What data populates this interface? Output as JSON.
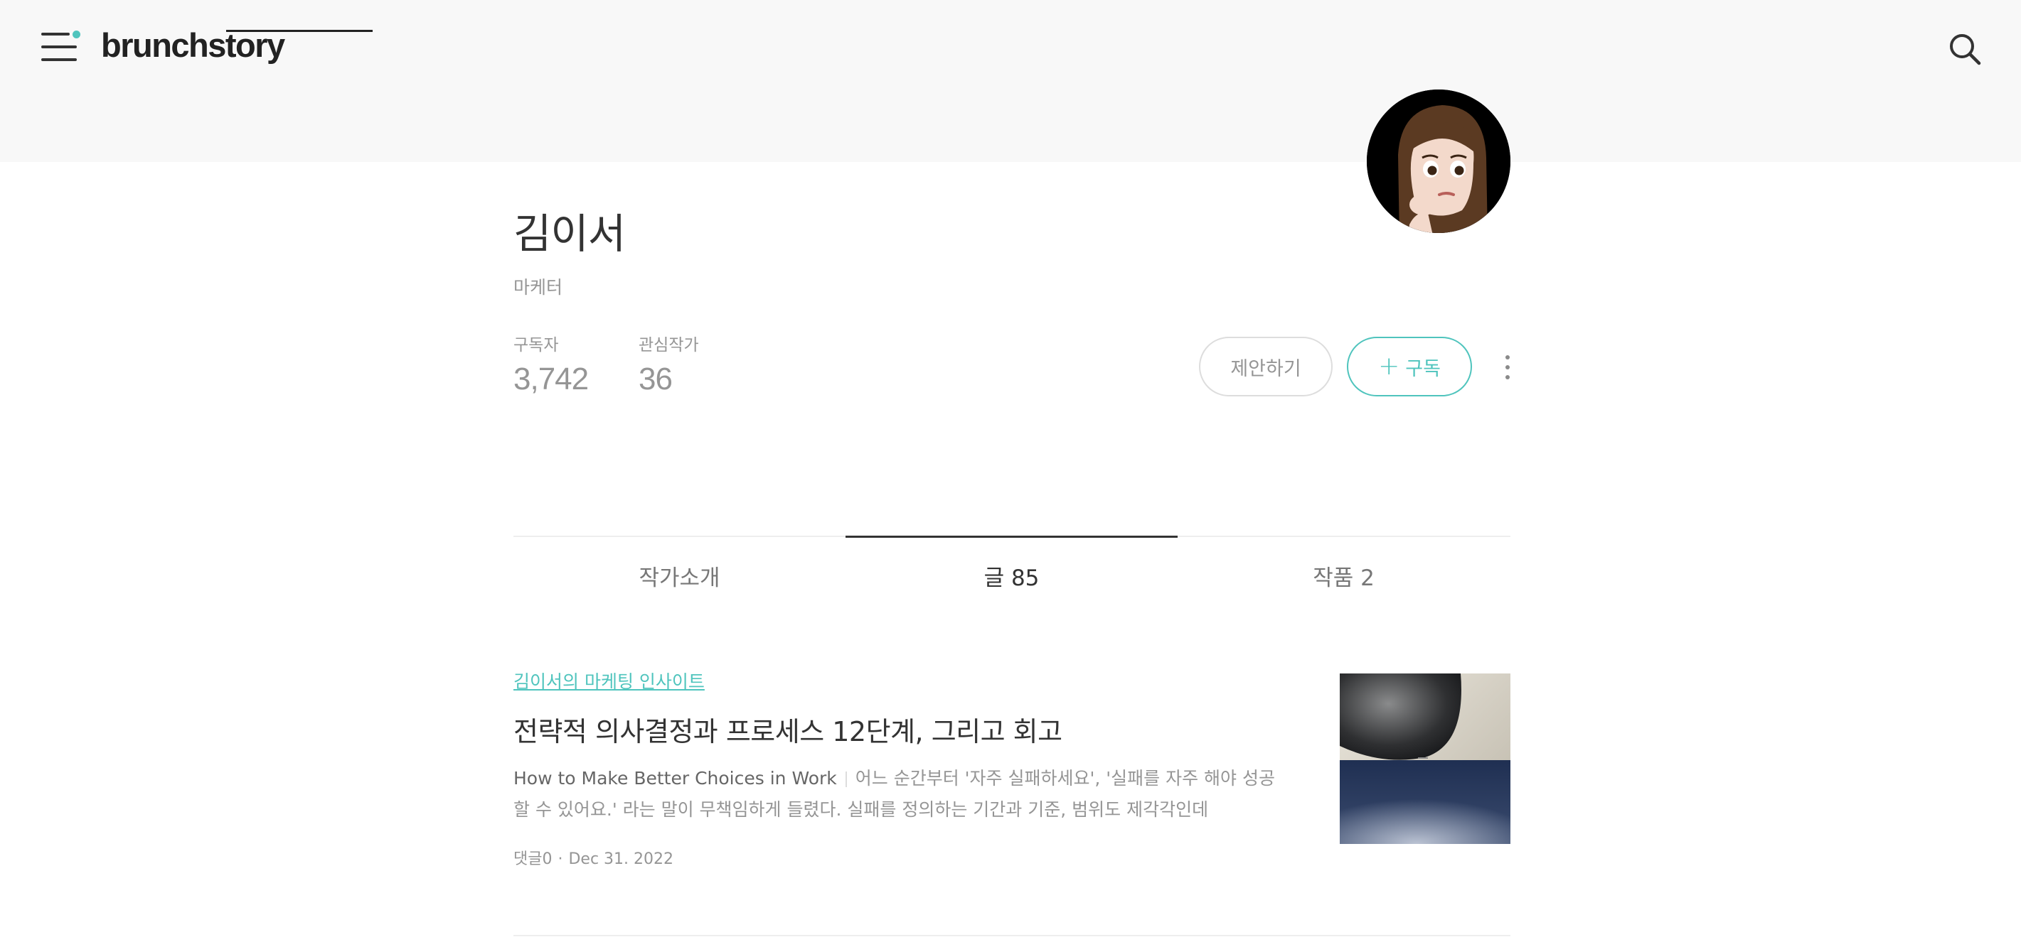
{
  "header": {
    "logo_text": "brunchstory",
    "menu_icon": "hamburger-menu-icon",
    "search_icon": "search-icon",
    "accent_dot_color": "#4fc4bd"
  },
  "profile": {
    "name": "김이서",
    "role": "마케터",
    "stats": [
      {
        "label": "구독자",
        "value": "3,742"
      },
      {
        "label": "관심작가",
        "value": "36"
      }
    ],
    "buttons": {
      "suggest": "제안하기",
      "subscribe_plus": "+",
      "subscribe": "구독"
    },
    "more_icon": "vertical-dots-icon"
  },
  "tabs": [
    {
      "label": "작가소개",
      "active": false
    },
    {
      "label": "글 85",
      "active": true
    },
    {
      "label": "작품 2",
      "active": false
    }
  ],
  "articles": [
    {
      "magazine": "김이서의 마케팅 인사이트",
      "title": "전략적 의사결정과 프로세스 12단계, 그리고 회고",
      "subtitle": "How to Make Better Choices in Work",
      "excerpt": "어느 순간부터 '자주 실패하세요', '실패를 자주 해야 성공할 수 있어요.' 라는 말이 무책임하게 들렸다. 실패를 정의하는 기간과 기준, 범위도 제각각인데",
      "comments": "댓글0",
      "date": "Dec 31. 2022"
    }
  ],
  "colors": {
    "accent": "#4fc4bd",
    "header_bg": "#f8f8f8",
    "text_primary": "#333333",
    "text_muted": "#959595"
  }
}
